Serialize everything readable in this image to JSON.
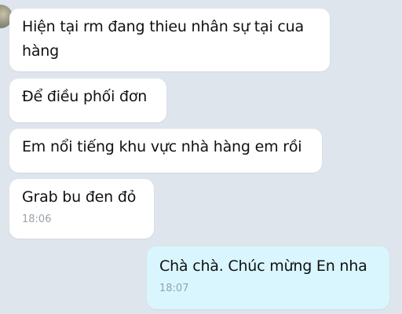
{
  "messages": [
    {
      "direction": "incoming",
      "text": "Hiện tại rm đang thieu nhân sự tại cua hàng"
    },
    {
      "direction": "incoming",
      "text": "Để điều phối đơn"
    },
    {
      "direction": "incoming",
      "text": "Em nổi tiếng khu vực nhà hàng em rồi"
    },
    {
      "direction": "incoming",
      "text": "Grab bu đen đỏ",
      "time": "18:06"
    },
    {
      "direction": "outgoing",
      "text": "Chà chà. Chúc mừng En nha",
      "time": "18:07"
    }
  ],
  "colors": {
    "background": "#dfe5ed",
    "incoming_bubble": "#ffffff",
    "outgoing_bubble": "#d9f6ff",
    "timestamp": "#9aa1a8"
  }
}
